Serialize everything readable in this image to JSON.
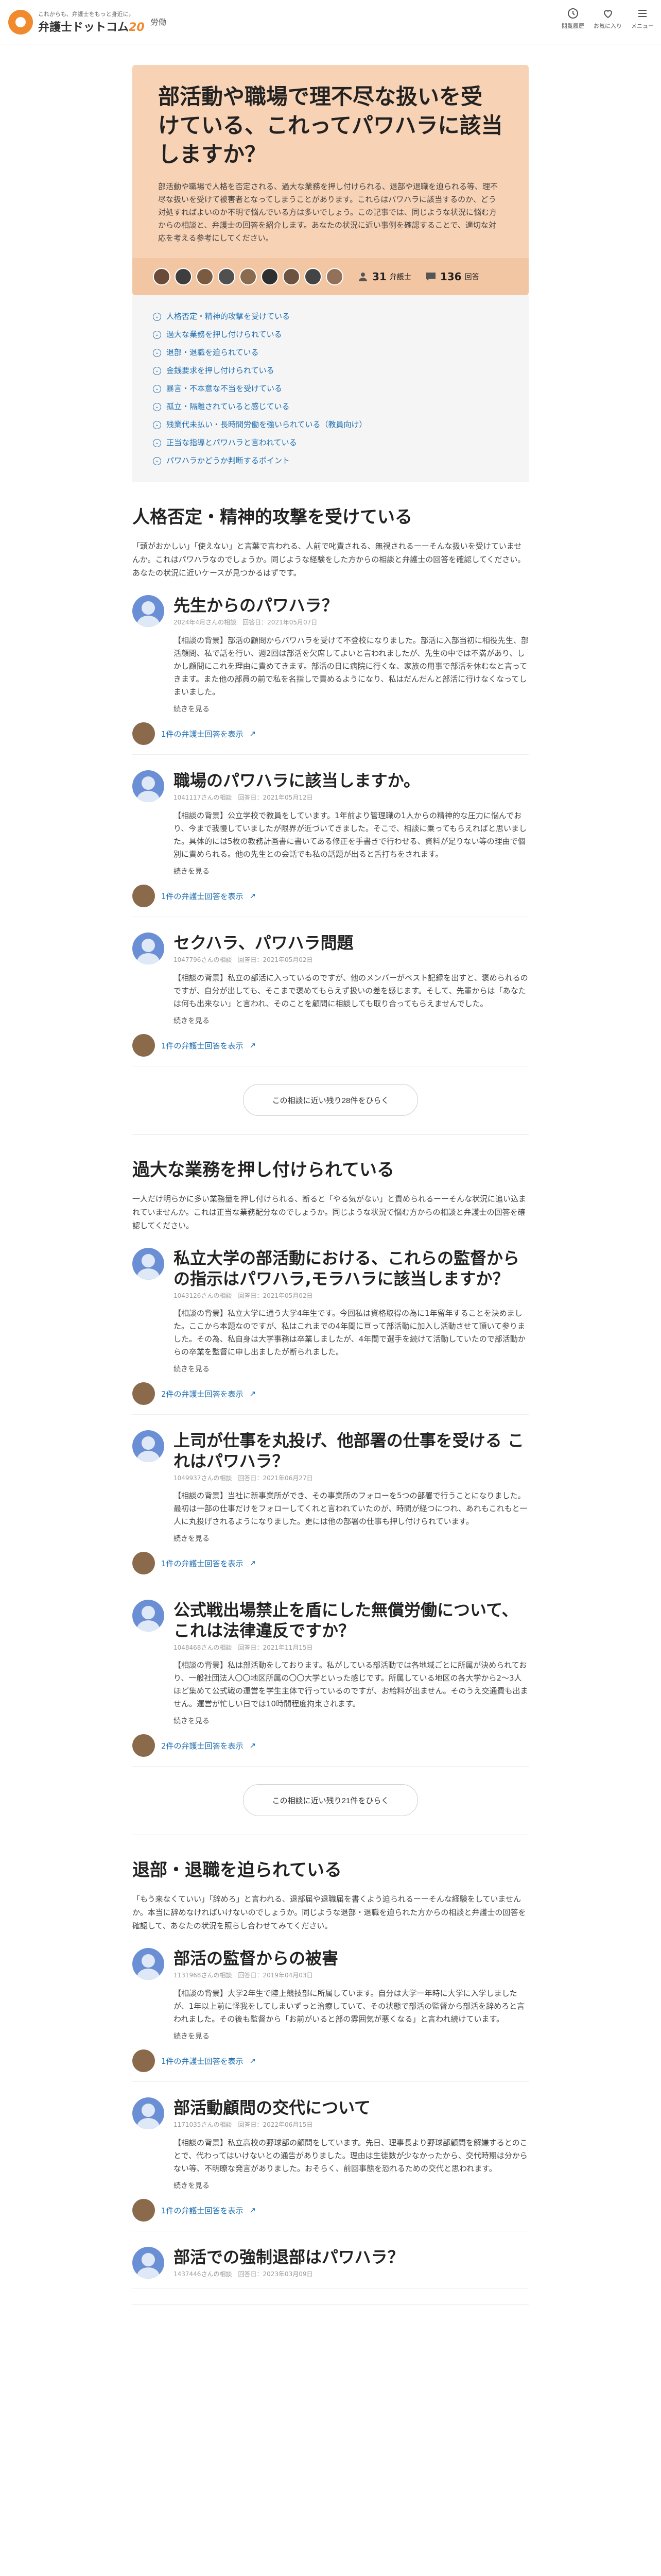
{
  "header": {
    "tagline": "これからも、弁護士をもっと身近に。",
    "site_name": "弁護士ドットコム",
    "anniversary": "20",
    "category": "労働",
    "actions": [
      {
        "label": "閲覧履歴",
        "icon": "history-icon"
      },
      {
        "label": "お気に入り",
        "icon": "heart-icon"
      },
      {
        "label": "メニュー",
        "icon": "menu-icon"
      }
    ]
  },
  "hero": {
    "title": "部活動や職場で理不尽な扱いを受けている、これってパワハラに該当しますか？",
    "description": "部活動や職場で人格を否定される、過大な業務を押し付けられる、退部や退職を迫られる等、理不尽な扱いを受けて被害者となってしまうことがあります。これらはパワハラに該当するのか、どう対処すればよいのか不明で悩んでいる方は多いでしょう。この記事では、同じような状況に悩む方からの相談と、弁護士の回答を紹介します。あなたの状況に近い事例を確認することで、適切な対応を考える参考にしてください。",
    "lawyers_count": "31",
    "lawyers_unit": "弁護士",
    "answers_count": "136",
    "answers_unit": "回答",
    "accent": "#f8d2b5"
  },
  "toc": [
    "人格否定・精神的攻撃を受けている",
    "過大な業務を押し付けられている",
    "退部・退職を迫られている",
    "金銭要求を押し付けられている",
    "暴言・不本意な不当を受けている",
    "孤立・隔離されていると感じている",
    "残業代未払い・長時間労働を強いられている（教員向け）",
    "正当な指導とパワハラと言われている",
    "パワハラかどうか判断するポイント"
  ],
  "sections": [
    {
      "title": "人格否定・精神的攻撃を受けている",
      "desc": "「頭がおかしい」「使えない」と言葉で言われる、人前で叱責される、無視されるーーそんな扱いを受けていませんか。これはパワハラなのでしょうか。同じような経験をした方からの相談と弁護士の回答を確認してください。あなたの状況に近いケースが見つかるはずです。",
      "questions": [
        {
          "title": "先生からのパワハラ？",
          "meta": "2024年4月さんの相談　回答日：2021年05月07日",
          "body": "【相談の背景】部活の顧問からパワハラを受けて不登校になりました。部活に入部当初に相役先生、部活顧問、私で話を行い、週2回は部活を欠席してよいと言われましたが、先生の中では不満があり、しかし顧問にこれを理由に責めてきます。部活の日に病院に行くな、家族の用事で部活を休むなと言ってきます。また他の部員の前で私を名指しで責めるようになり、私はだんだんと部活に行けなくなってしまいました。",
          "more": "続きを見る",
          "answers": "1件の弁護士回答を表示"
        },
        {
          "title": "職場のパワハラに該当しますか。",
          "meta": "1041117さんの相談　回答日：2021年05月12日",
          "body": "【相談の背景】公立学校で教員をしています。1年前より管理職の1人からの精神的な圧力に悩んでおり、今まで我慢していましたが限界が近づいてきました。そこで、相談に乗ってもらえればと思いました。具体的には5枚の教務計画書に書いてある修正を手書きで行わせる、資料が足りない等の理由で個別に責められる。他の先生との会話でも私の話題が出ると舌打ちをされます。",
          "more": "続きを見る",
          "answers": "1件の弁護士回答を表示"
        },
        {
          "title": "セクハラ、パワハラ問題",
          "meta": "1047796さんの相談　回答日：2021年05月02日",
          "body": "【相談の背景】私立の部活に入っているのですが、他のメンバーがベスト記録を出すと、褒められるのですが、自分が出しても、そこまで褒めてもらえず扱いの差を感じます。そして、先輩からは「あなたは何も出来ない」と言われ、そのことを顧問に相談しても取り合ってもらえませんでした。",
          "more": "続きを見る",
          "answers": "1件の弁護士回答を表示"
        }
      ],
      "more_btn": "この相談に近い残り28件をひらく"
    },
    {
      "title": "過大な業務を押し付けられている",
      "desc": "一人だけ明らかに多い業務量を押し付けられる、断ると「やる気がない」と責められるーーそんな状況に追い込まれていませんか。これは正当な業務配分なのでしょうか。同じような状況で悩む方からの相談と弁護士の回答を確認してください。",
      "questions": [
        {
          "title": "私立大学の部活動における、これらの監督からの指示はパワハラ,モラハラに該当しますか？",
          "meta": "1043126さんの相談　回答日：2021年05月02日",
          "body": "【相談の背景】私立大学に通う大学4年生です。今回私は資格取得の為に1年留年することを決めました。ここから本題なのですが、私はこれまでの4年間に亘って部活動に加入し活動させて頂いて参りました。その為、私自身は大学事務は卒業しましたが、4年間で選手を続けて活動していたので部活動からの卒業を監督に申し出ましたが断られました。",
          "more": "続きを見る",
          "answers": "2件の弁護士回答を表示"
        },
        {
          "title": "上司が仕事を丸投げ、他部署の仕事を受ける これはパワハラ？",
          "meta": "1049937さんの相談　回答日：2021年06月27日",
          "body": "【相談の背景】当社に新事業所ができ、その事業所のフォローを5つの部署で行うことになりました。最初は一部の仕事だけをフォローしてくれと言われていたのが、時間が経つにつれ、あれもこれもと一人に丸投げされるようになりました。更には他の部署の仕事も押し付けられています。",
          "more": "続きを見る",
          "answers": "1件の弁護士回答を表示"
        },
        {
          "title": "公式戦出場禁止を盾にした無償労働について、これは法律違反ですか？",
          "meta": "1048468さんの相談　回答日：2021年11月15日",
          "body": "【相談の背景】私は部活動をしております。私がしている部活動では各地域ごとに所属が決められており、一般社団法人〇〇地区所属の〇〇大学といった感じです。所属している地区の各大学から2～3人ほど集めて公式戦の運営を学生主体で行っているのですが、お給料が出ません。そのうえ交通費も出ません。運営が忙しい日では10時間程度拘束されます。",
          "more": "続きを見る",
          "answers": "2件の弁護士回答を表示"
        }
      ],
      "more_btn": "この相談に近い残り21件をひらく"
    },
    {
      "title": "退部・退職を迫られている",
      "desc": "「もう来なくていい」「辞めろ」と言われる、退部届や退職届を書くよう迫られるーーそんな経験をしていませんか。本当に辞めなければいけないのでしょうか。同じような退部・退職を迫られた方からの相談と弁護士の回答を確認して、あなたの状況を照らし合わせてみてください。",
      "questions": [
        {
          "title": "部活の監督からの被害",
          "meta": "1131968さんの相談　回答日：2019年04月03日",
          "body": "【相談の背景】大学2年生で陸上競技部に所属しています。自分は大学一年時に大学に入学しましたが、1年以上前に怪我をしてしまいずっと治療していて、その状態で部活の監督から部活を辞めろと言われました。その後も監督から「お前がいると部の雰囲気が悪くなる」と言われ続けています。",
          "more": "続きを見る",
          "answers": "1件の弁護士回答を表示"
        },
        {
          "title": "部活動顧問の交代について",
          "meta": "1171035さんの相談　回答日：2022年06月15日",
          "body": "【相談の背景】私立高校の野球部の顧問をしています。先日、理事長より野球部顧問を解嫌するとのことで、代わってはいけないとの通告がありました。理由は生徒数が少なかったから、交代時期は分からない等、不明瞭な発言がありました。おそらく、前回事態を恐れるための交代と思われます。",
          "more": "続きを見る",
          "answers": "1件の弁護士回答を表示"
        },
        {
          "title": "部活での強制退部はパワハラ？",
          "meta": "1437446さんの相談　回答日：2023年03月09日",
          "body": "",
          "more": "",
          "answers": ""
        }
      ],
      "more_btn": ""
    }
  ]
}
